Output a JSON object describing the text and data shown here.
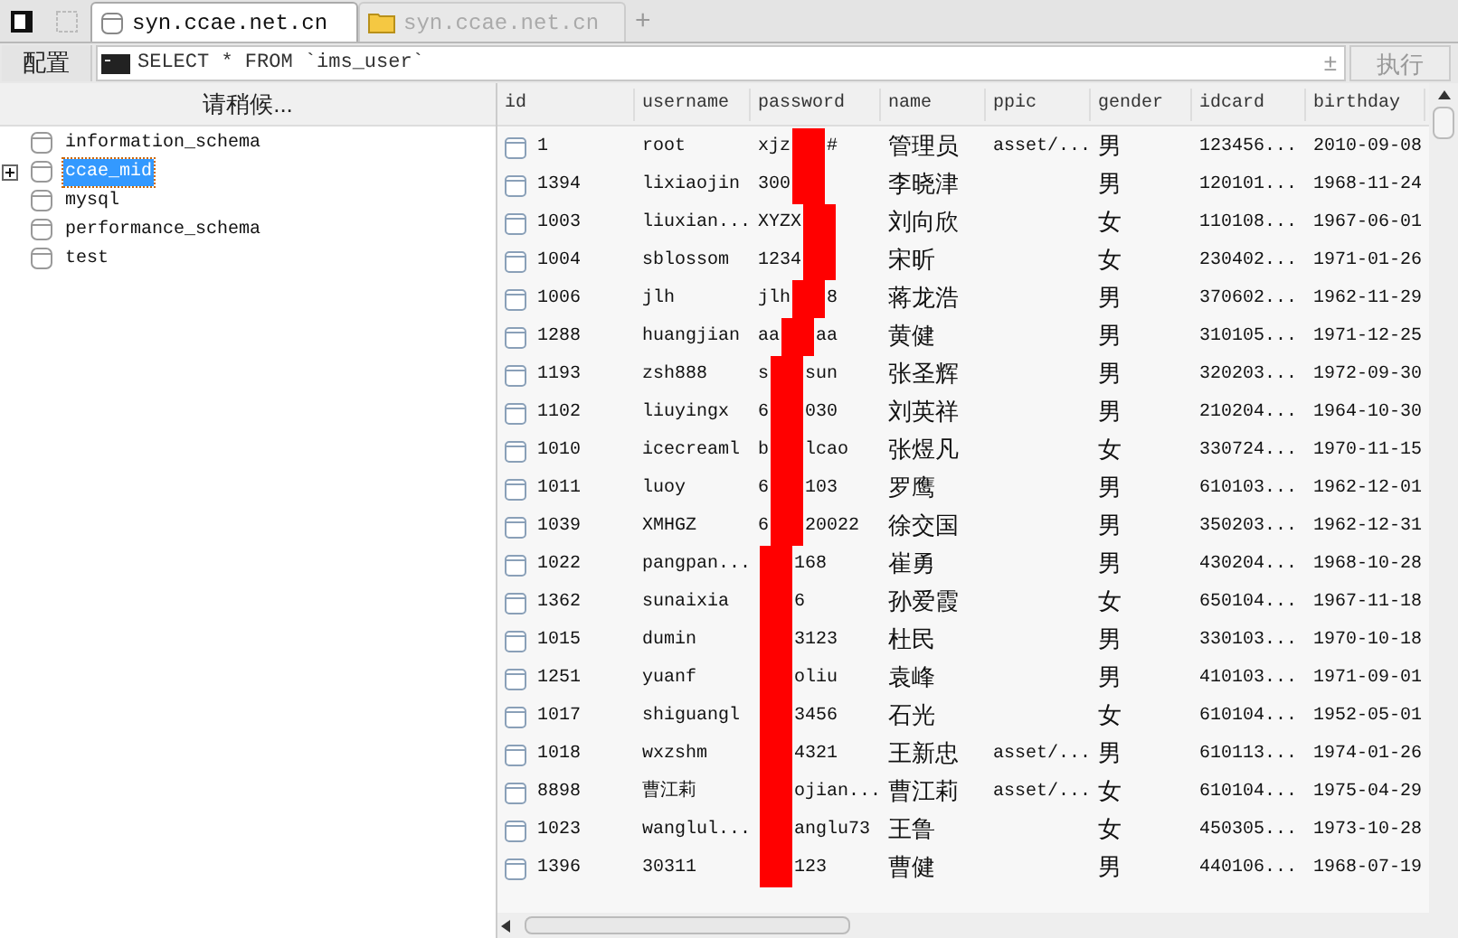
{
  "tabs": [
    {
      "label": "syn.ccae.net.cn",
      "selected": true,
      "kind": "database"
    },
    {
      "label": "syn.ccae.net.cn",
      "selected": false,
      "kind": "folder"
    }
  ],
  "new_tab": "+",
  "toolbar": {
    "config_button": "配置",
    "query": "SELECT * FROM `ims_user`",
    "expand_toggle": "±",
    "run_button": "执行"
  },
  "sidebar": {
    "header": "请稍候...",
    "items": [
      {
        "label": "information_schema",
        "selected": false,
        "expandable": false
      },
      {
        "label": "ccae_mid",
        "selected": true,
        "expandable": true
      },
      {
        "label": "mysql",
        "selected": false,
        "expandable": false
      },
      {
        "label": "performance_schema",
        "selected": false,
        "expandable": false
      },
      {
        "label": "test",
        "selected": false,
        "expandable": false
      }
    ]
  },
  "table": {
    "columns": [
      "id",
      "username",
      "password",
      "name",
      "ppic",
      "gender",
      "idcard",
      "birthday"
    ],
    "rows": [
      {
        "id": "1",
        "username": "root",
        "password_visible_before": "xjz",
        "password_visible_after": "#",
        "name": "管理员",
        "ppic": "asset/...",
        "gender": "男",
        "idcard": "123456...",
        "birthday": "2010-09-08"
      },
      {
        "id": "1394",
        "username": "lixiaojin",
        "password_visible_before": "300",
        "name": "李晓津",
        "gender": "男",
        "idcard": "120101...",
        "birthday": "1968-11-24"
      },
      {
        "id": "1003",
        "username": "liuxian...",
        "password_visible_before": "XYZX",
        "name": "刘向欣",
        "gender": "女",
        "idcard": "110108...",
        "birthday": "1967-06-01"
      },
      {
        "id": "1004",
        "username": "sblossom",
        "password_visible_before": "1234",
        "name": "宋昕",
        "gender": "女",
        "idcard": "230402...",
        "birthday": "1971-01-26"
      },
      {
        "id": "1006",
        "username": "jlh",
        "password_visible_before": "jlh",
        "password_visible_after": "8",
        "name": "蒋龙浩",
        "gender": "男",
        "idcard": "370602...",
        "birthday": "1962-11-29"
      },
      {
        "id": "1288",
        "username": "huangjian",
        "password_visible_before": "aa",
        "password_visible_after": "aa",
        "name": "黄健",
        "gender": "男",
        "idcard": "310105...",
        "birthday": "1971-12-25"
      },
      {
        "id": "1193",
        "username": "zsh888",
        "password_visible_before": "s",
        "password_visible_after": "sun",
        "name": "张圣辉",
        "gender": "男",
        "idcard": "320203...",
        "birthday": "1972-09-30"
      },
      {
        "id": "1102",
        "username": "liuyingx",
        "password_visible_before": "6",
        "password_visible_after": "030",
        "name": "刘英祥",
        "gender": "男",
        "idcard": "210204...",
        "birthday": "1964-10-30"
      },
      {
        "id": "1010",
        "username": "icecreaml",
        "password_visible_before": "b",
        "password_visible_after": "lcao",
        "name": "张煜凡",
        "gender": "女",
        "idcard": "330724...",
        "birthday": "1970-11-15"
      },
      {
        "id": "1011",
        "username": "luoy",
        "password_visible_before": "6",
        "password_visible_after": "103",
        "name": "罗鹰",
        "gender": "男",
        "idcard": "610103...",
        "birthday": "1962-12-01"
      },
      {
        "id": "1039",
        "username": "XMHGZ",
        "password_visible_before": "6",
        "password_visible_after": "20022",
        "name": "徐交国",
        "gender": "男",
        "idcard": "350203...",
        "birthday": "1962-12-31"
      },
      {
        "id": "1022",
        "username": "pangpan...",
        "password_visible_after": "168",
        "name": "崔勇",
        "gender": "男",
        "idcard": "430204...",
        "birthday": "1968-10-28"
      },
      {
        "id": "1362",
        "username": "sunaixia",
        "password_visible_after": "6",
        "name": "孙爱霞",
        "gender": "女",
        "idcard": "650104...",
        "birthday": "1967-11-18"
      },
      {
        "id": "1015",
        "username": "dumin",
        "password_visible_after": "3123",
        "name": "杜民",
        "gender": "男",
        "idcard": "330103...",
        "birthday": "1970-10-18"
      },
      {
        "id": "1251",
        "username": "yuanf",
        "password_visible_after": "oliu",
        "name": "袁峰",
        "gender": "男",
        "idcard": "410103...",
        "birthday": "1971-09-01"
      },
      {
        "id": "1017",
        "username": "shiguangl",
        "password_visible_after": "3456",
        "name": "石光",
        "gender": "女",
        "idcard": "610104...",
        "birthday": "1952-05-01"
      },
      {
        "id": "1018",
        "username": "wxzshm",
        "password_visible_after": "4321",
        "name": "王新忠",
        "ppic": "asset/...",
        "gender": "男",
        "idcard": "610113...",
        "birthday": "1974-01-26"
      },
      {
        "id": "8898",
        "username": "曹江莉",
        "password_visible_after": "ojian...",
        "name": "曹江莉",
        "ppic": "asset/...",
        "gender": "女",
        "idcard": "610104...",
        "birthday": "1975-04-29"
      },
      {
        "id": "1023",
        "username": "wanglul...",
        "password_visible_after": "anglu73",
        "name": "王鲁",
        "gender": "女",
        "idcard": "450305...",
        "birthday": "1973-10-28"
      },
      {
        "id": "1396",
        "username": "30311",
        "password_visible_after": "123",
        "name": "曹健",
        "gender": "男",
        "idcard": "440106...",
        "birthday": "1968-07-19"
      }
    ]
  }
}
